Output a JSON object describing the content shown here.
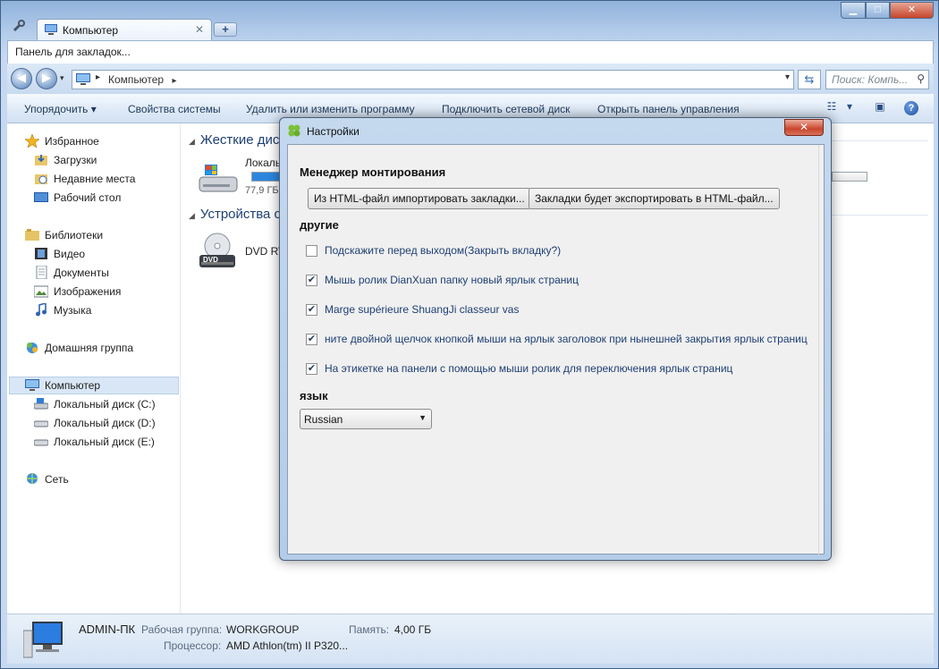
{
  "tabstrip": {
    "tab_title": "Компьютер",
    "new_tab": "+"
  },
  "window_buttons": {
    "minimize": "▁",
    "maximize": "□",
    "close": "✕"
  },
  "bookmarks_bar": {
    "text": "Панель для закладок..."
  },
  "address": {
    "crumb": "Компьютер",
    "search_placeholder": "Поиск: Компь..."
  },
  "commands": {
    "organize": "Упорядочить ▾",
    "system_props": "Свойства системы",
    "uninstall": "Удалить или изменить программу",
    "map_drive": "Подключить сетевой диск",
    "control_panel": "Открыть панель управления"
  },
  "nav": {
    "favorites": "Избранное",
    "downloads": "Загрузки",
    "recent": "Недавние места",
    "desktop": "Рабочий стол",
    "libraries": "Библиотеки",
    "video": "Видео",
    "documents": "Документы",
    "images": "Изображения",
    "music": "Музыка",
    "homegroup": "Домашняя группа",
    "computer": "Компьютер",
    "disk_c": "Локальный диск (C:)",
    "disk_d": "Локальный диск (D:)",
    "disk_e": "Локальный диск (E:)",
    "network": "Сеть"
  },
  "main": {
    "group_hdd": "Жесткие диск",
    "drive_c_label": "Локаль",
    "drive_c_sub": "77,9 ГБ",
    "group_removable": "Устройства с",
    "dvd_label": "DVD RV",
    "dvd_badge": "DVD"
  },
  "details": {
    "name": "ADMIN-ПК",
    "workgroup_label": "Рабочая группа:",
    "workgroup_value": "WORKGROUP",
    "memory_label": "Память:",
    "memory_value": "4,00 ГБ",
    "cpu_label": "Процессор:",
    "cpu_value": "AMD Athlon(tm) II P320..."
  },
  "dialog": {
    "title": "Настройки",
    "close": "✕",
    "section_mount": "Менеджер монтирования",
    "import_btn": "Из HTML-файл импортировать закладки...",
    "export_btn": "Закладки будет экспортировать в HTML-файл...",
    "section_other": "другие",
    "options": [
      {
        "label": "Подскажите перед выходом(Закрыть вкладку?)",
        "checked": false
      },
      {
        "label": "Мышь ролик DianXuan папку новый ярлык страниц",
        "checked": true
      },
      {
        "label": "Marge supérieure ShuangJi classeur vas",
        "checked": true
      },
      {
        "label": "ните двойной щелчок кнопкой мыши на ярлык заголовок при нынешней закрытия ярлык страниц",
        "checked": true
      },
      {
        "label": "На этикетке на панели с помощью мыши ролик для переключения ярлык страниц",
        "checked": true
      }
    ],
    "section_lang": "язык",
    "language_selected": "Russian"
  }
}
